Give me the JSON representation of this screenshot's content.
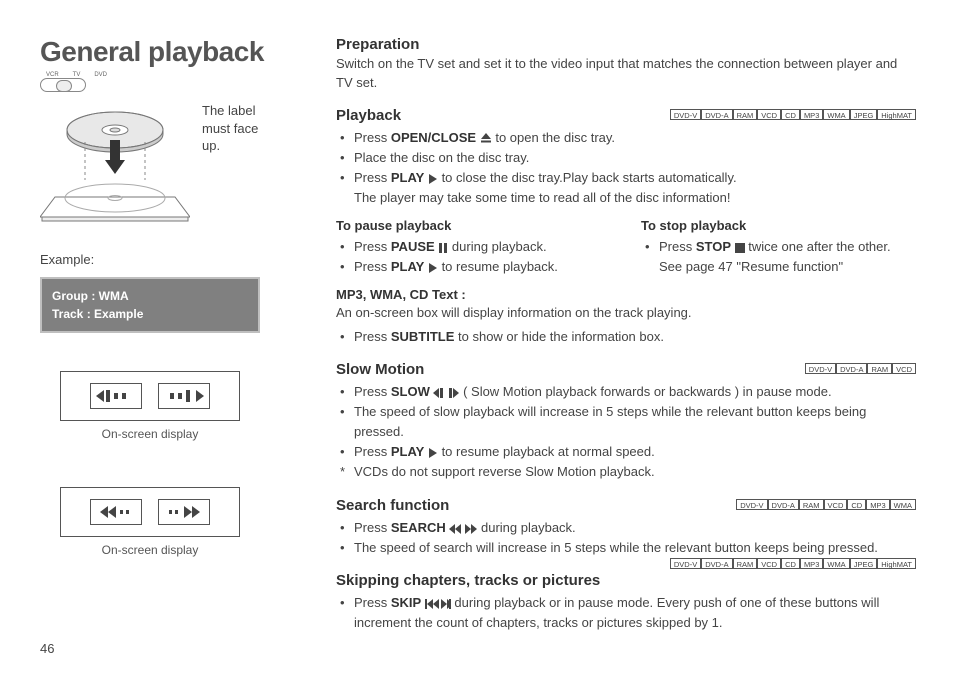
{
  "page_number": "46",
  "title": "General playback",
  "switch": {
    "left": "VCR",
    "mid": "TV",
    "right": "DVD"
  },
  "disc": {
    "caption_l1": "The label",
    "caption_l2": "must face",
    "caption_l3": "up."
  },
  "example": {
    "label": "Example:",
    "line1_label": "Group : ",
    "line1_value": "WMA",
    "line2_label": "Track  : ",
    "line2_value": "Example"
  },
  "osd1_caption": "On-screen display",
  "osd2_caption": "On-screen display",
  "sections": {
    "preparation": {
      "title": "Preparation",
      "body": "Switch on the TV set and set it to the video input that matches the connection between player and TV set."
    },
    "playback": {
      "title": "Playback",
      "formats": [
        "DVD-V",
        "DVD-A",
        "RAM",
        "VCD",
        "CD",
        "MP3",
        "WMA",
        "JPEG",
        "HighMAT"
      ],
      "b1a": "Press ",
      "b1b": "OPEN/CLOSE",
      "b1c": " to open the disc tray.",
      "b2": "Place the disc on the disc tray.",
      "b3a": "Press ",
      "b3b": "PLAY",
      "b3c": " to close the disc tray.Play back starts automatically.",
      "b3d": "The player may take some time to read all of the disc information!"
    },
    "pause": {
      "title": "To pause playback",
      "b1a": "Press ",
      "b1b": "PAUSE",
      "b1c": " during playback.",
      "b2a": "Press ",
      "b2b": "PLAY",
      "b2c": "  to resume playback."
    },
    "stop": {
      "title": "To stop playback",
      "b1a": "Press ",
      "b1b": "STOP",
      "b1c": "  twice one after the other.",
      "note": "See page 47 \"Resume function\""
    },
    "mp3": {
      "title": "MP3, WMA, CD Text :",
      "body": "An on-screen box will display information on the track playing.",
      "b1a": "Press ",
      "b1b": "SUBTITLE",
      "b1c": " to show or hide the information box."
    },
    "slow": {
      "title": "Slow Motion",
      "formats": [
        "DVD-V",
        "DVD-A",
        "RAM",
        "VCD"
      ],
      "b1a": "Press ",
      "b1b": "SLOW",
      "b1c": " ( Slow Motion playback forwards or backwards ) in pause mode.",
      "b2": "The speed of slow playback will increase in 5 steps while the relevant button keeps being pressed.",
      "b3a": "Press ",
      "b3b": "PLAY",
      "b3c": " to resume playback at normal speed.",
      "b4": "VCDs do not support reverse Slow Motion playback."
    },
    "search": {
      "title": "Search function",
      "formats": [
        "DVD-V",
        "DVD-A",
        "RAM",
        "VCD",
        "CD",
        "MP3",
        "WMA"
      ],
      "b1a": "Press ",
      "b1b": "SEARCH",
      "b1c": " during playback.",
      "b2": "The speed of search will increase in 5 steps while the relevant button keeps being pressed."
    },
    "skip": {
      "title": "Skipping chapters, tracks or pictures",
      "formats": [
        "DVD-V",
        "DVD-A",
        "RAM",
        "VCD",
        "CD",
        "MP3",
        "WMA",
        "JPEG",
        "HighMAT"
      ],
      "b1a": "Press ",
      "b1b": "SKIP",
      "b1c": "  during playback or in pause mode. Every push of one of these buttons will increment the count of chapters, tracks or pictures skipped by 1."
    }
  }
}
